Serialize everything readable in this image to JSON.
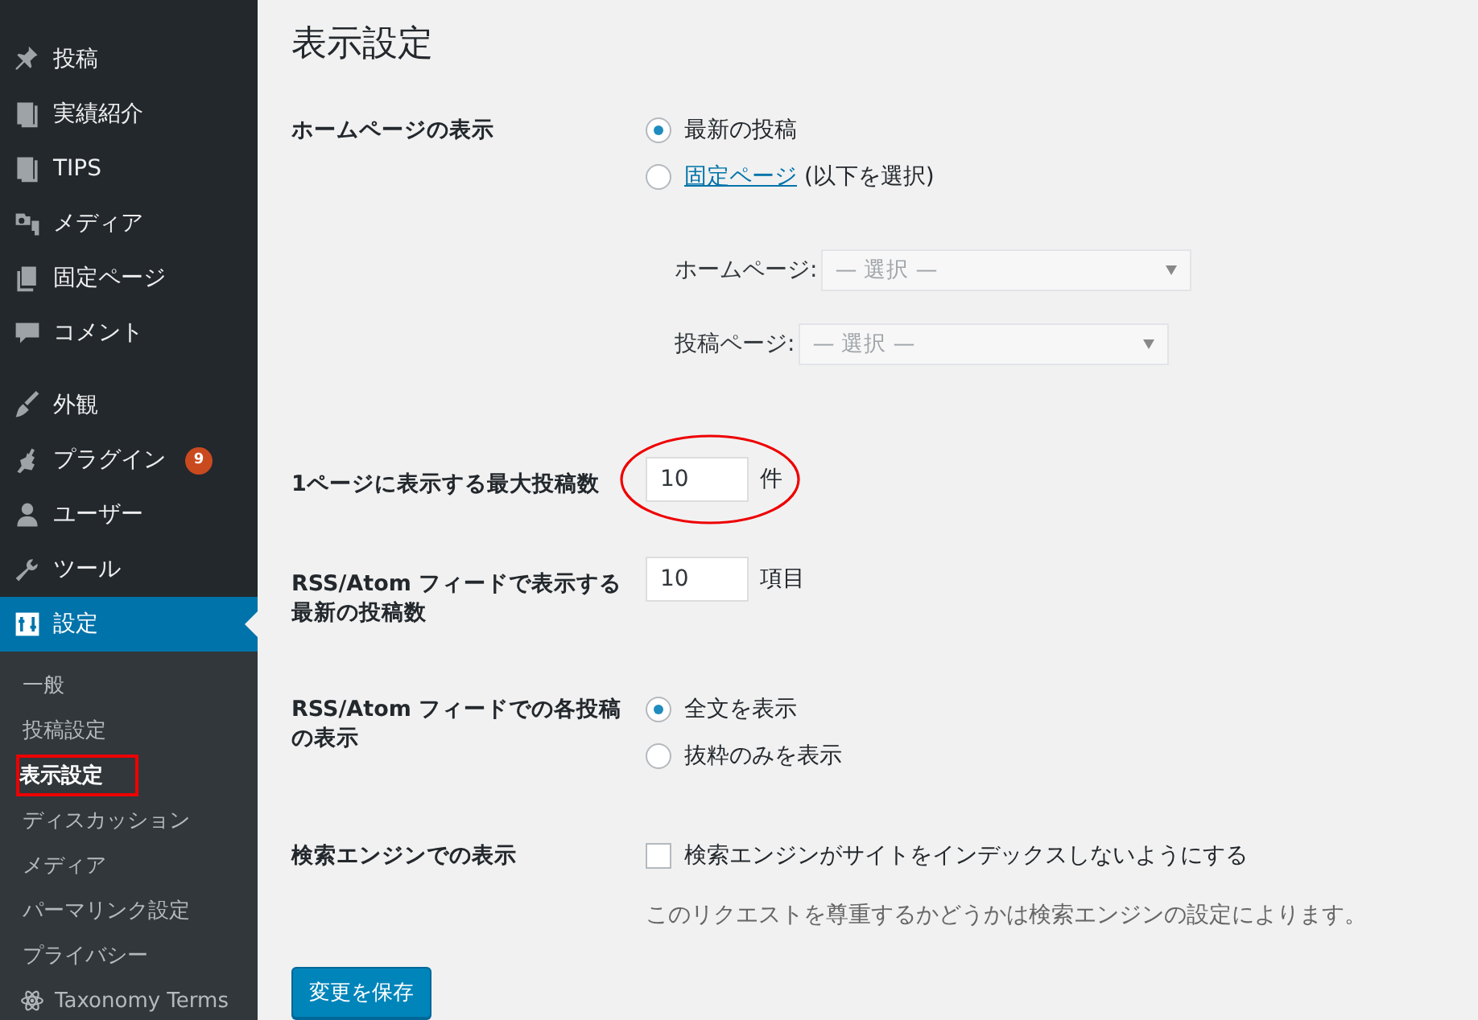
{
  "sidebar": {
    "menu_groups": [
      [
        {
          "label": "投稿",
          "selected": false
        },
        {
          "label": "実績紹介",
          "selected": false
        },
        {
          "label": "TIPS",
          "selected": false
        },
        {
          "label": "メディア",
          "selected": false
        },
        {
          "label": "固定ページ",
          "selected": false
        },
        {
          "label": "コメント",
          "selected": false
        }
      ],
      [
        {
          "label": "外観",
          "selected": false
        },
        {
          "label": "プラグイン",
          "selected": false,
          "badge": "9"
        },
        {
          "label": "ユーザー",
          "selected": false
        },
        {
          "label": "ツール",
          "selected": false
        },
        {
          "label": "設定",
          "selected": true
        }
      ]
    ],
    "submenu": [
      {
        "label": "一般",
        "selected": false,
        "highlighted": false
      },
      {
        "label": "投稿設定",
        "selected": false,
        "highlighted": false
      },
      {
        "label": "表示設定",
        "selected": true,
        "highlighted": true
      },
      {
        "label": "ディスカッション",
        "selected": false,
        "highlighted": false
      },
      {
        "label": "メディア",
        "selected": false,
        "highlighted": false
      },
      {
        "label": "パーマリンク設定",
        "selected": false,
        "highlighted": false
      },
      {
        "label": "プライバシー",
        "selected": false,
        "highlighted": false
      },
      {
        "label": "Taxonomy Terms",
        "selected": false,
        "highlighted": false
      }
    ]
  },
  "page": {
    "title": "表示設定",
    "rows": [
      {
        "kind": "radio",
        "label": "ホームページの表示",
        "options": [
          {
            "kind": "text",
            "label": "最新の投稿",
            "selected": true
          },
          {
            "kind": "link",
            "label": "固定ページ",
            "note": "(以下を選択)",
            "selected": false
          }
        ],
        "selects": [
          {
            "label": "ホームページ:",
            "placeholder": "— 選択 —",
            "disabled": true
          },
          {
            "label": "投稿ページ:",
            "placeholder": "— 選択 —",
            "disabled": true
          }
        ]
      },
      {
        "kind": "number",
        "label": "1ページに表示する最大投稿数",
        "value": "10",
        "unit": "件",
        "highlighted": true
      },
      {
        "kind": "number",
        "label": "RSS/Atom フィードで表示する最新の投稿数",
        "value": "10",
        "unit": "項目"
      },
      {
        "kind": "radio",
        "label": "RSS/Atom フィードでの各投稿の表示",
        "options": [
          {
            "kind": "text",
            "label": "全文を表示",
            "selected": true
          },
          {
            "kind": "text",
            "label": "抜粋のみを表示",
            "selected": false
          }
        ]
      },
      {
        "kind": "checkbox",
        "label": "検索エンジンでの表示",
        "option": "検索エンジンがサイトをインデックスしないようにする",
        "checked": false,
        "description": "このリクエストを尊重するかどうかは検索エンジンの設定によります。"
      }
    ],
    "save_button": "変更を保存"
  }
}
